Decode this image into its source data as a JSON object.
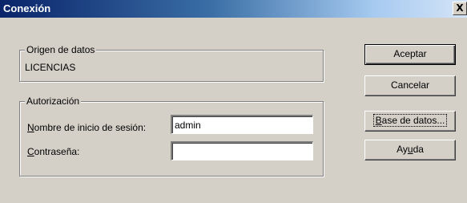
{
  "window": {
    "title": "Conexión",
    "close_label": "X"
  },
  "data_source": {
    "legend": "Origen de datos",
    "value": "LICENCIAS"
  },
  "authorization": {
    "legend": "Autorización",
    "username_label_mnemonic": "N",
    "username_label_rest": "ombre de inicio de sesión:",
    "username_value": "admin",
    "password_label_mnemonic": "C",
    "password_label_rest": "ontraseña:",
    "password_value": ""
  },
  "buttons": {
    "accept": "Aceptar",
    "cancel": "Cancelar",
    "database_mnemonic": "B",
    "database_rest": "ase de datos...",
    "help_before": "Ay",
    "help_mnemonic": "u",
    "help_after": "da"
  }
}
